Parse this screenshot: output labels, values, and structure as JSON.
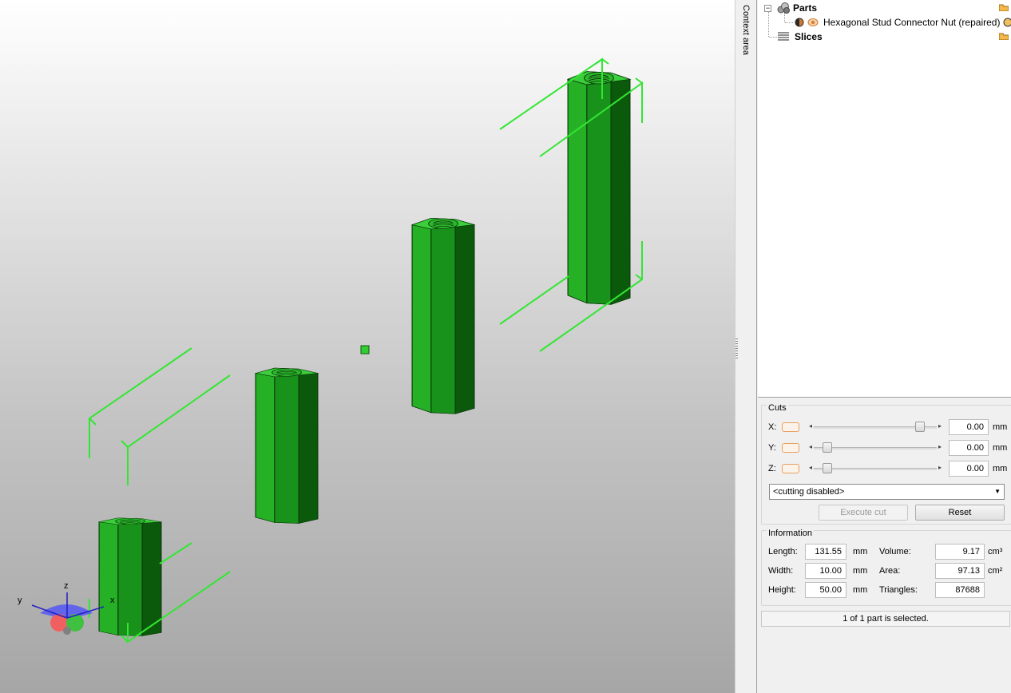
{
  "tree": {
    "parts_label": "Parts",
    "part_name": "Hexagonal Stud Connector Nut (repaired)",
    "slices_label": "Slices"
  },
  "sidebar": {
    "context_label": "Context area"
  },
  "cuts": {
    "title": "Cuts",
    "x": {
      "label": "X:",
      "value": "0.00",
      "unit": "mm",
      "slider_fraction": 1.0
    },
    "y": {
      "label": "Y:",
      "value": "0.00",
      "unit": "mm",
      "slider_fraction": 0.0
    },
    "z": {
      "label": "Z:",
      "value": "0.00",
      "unit": "mm",
      "slider_fraction": 0.0
    },
    "mode_selected": "<cutting disabled>",
    "execute_label": "Execute cut",
    "reset_label": "Reset"
  },
  "info": {
    "title": "Information",
    "length_label": "Length:",
    "length_value": "131.55",
    "length_unit": "mm",
    "width_label": "Width:",
    "width_value": "10.00",
    "width_unit": "mm",
    "height_label": "Height:",
    "height_value": "50.00",
    "height_unit": "mm",
    "volume_label": "Volume:",
    "volume_value": "9.17",
    "volume_unit": "cm³",
    "area_label": "Area:",
    "area_value": "97.13",
    "area_unit": "cm²",
    "triangles_label": "Triangles:",
    "triangles_value": "87688"
  },
  "status": {
    "text": "1 of 1 part is selected."
  },
  "axis_gizmo": {
    "x": "x",
    "y": "y",
    "z": "z"
  },
  "colors": {
    "part": "#22a822",
    "selection": "#33e633",
    "accent_orange": "#e8a060"
  }
}
